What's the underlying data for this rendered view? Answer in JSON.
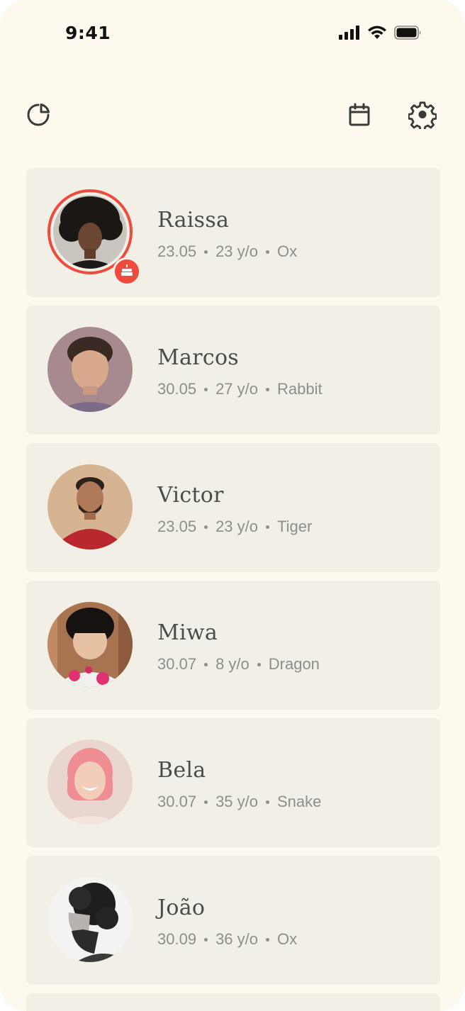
{
  "status_bar": {
    "time": "9:41",
    "icons": [
      "cellular-signal-icon",
      "wifi-icon",
      "battery-icon"
    ]
  },
  "toolbar": {
    "left": "stats-pie-icon",
    "right": [
      "calendar-icon",
      "settings-gear-icon"
    ]
  },
  "colors": {
    "background": "#fdf9ee",
    "card": "#f1efe6",
    "accent": "#ef4a3c",
    "name_text": "#4b4b49",
    "meta_text": "#8e8e8a"
  },
  "people": [
    {
      "name": "Raissa",
      "date": "23.05",
      "age": "23 y/o",
      "zodiac": "Ox",
      "birthday_today": true
    },
    {
      "name": "Marcos",
      "date": "30.05",
      "age": "27 y/o",
      "zodiac": "Rabbit",
      "birthday_today": false
    },
    {
      "name": "Victor",
      "date": "23.05",
      "age": "23 y/o",
      "zodiac": "Tiger",
      "birthday_today": false
    },
    {
      "name": "Miwa",
      "date": "30.07",
      "age": "8 y/o",
      "zodiac": "Dragon",
      "birthday_today": false
    },
    {
      "name": "Bela",
      "date": "30.07",
      "age": "35 y/o",
      "zodiac": "Snake",
      "birthday_today": false
    },
    {
      "name": "João",
      "date": "30.09",
      "age": "36 y/o",
      "zodiac": "Ox",
      "birthday_today": false
    }
  ]
}
